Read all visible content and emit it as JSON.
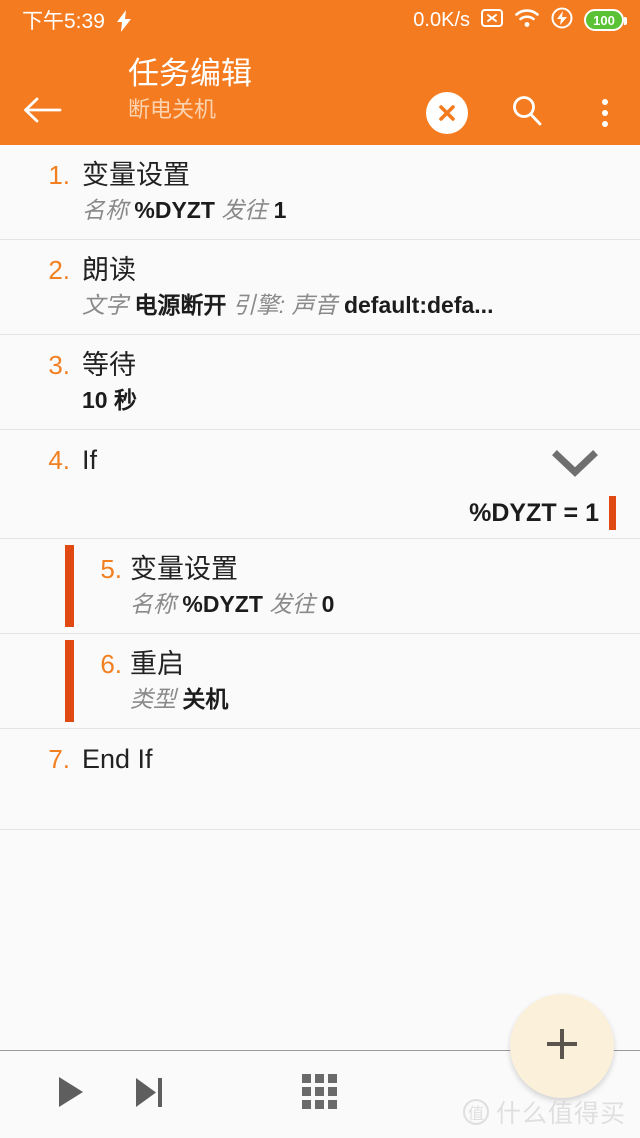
{
  "statusbar": {
    "time": "下午5:39",
    "charging_icon": "lightning-bolt-icon",
    "data_rate": "0.0K/s",
    "sim_icon": "no-sim-icon",
    "wifi_icon": "wifi-icon",
    "power_icon": "power-saver-icon",
    "battery_level": "100",
    "background_color": "#F47B20"
  },
  "appbar": {
    "back_icon": "back-arrow-icon",
    "title": "任务编辑",
    "subtitle": "断电关机",
    "close_icon": "close-circle-icon",
    "search_icon": "search-icon",
    "more_icon": "overflow-menu-icon",
    "background_color": "#F47B20",
    "accent_color": "#F28021"
  },
  "actions": [
    {
      "number": "1.",
      "title": "变量设置",
      "indented": false,
      "parts": [
        {
          "type": "label",
          "text": "名称"
        },
        {
          "type": "value",
          "text": "%DYZT"
        },
        {
          "type": "label",
          "text": "发往"
        },
        {
          "type": "value",
          "text": "1"
        }
      ]
    },
    {
      "number": "2.",
      "title": "朗读",
      "indented": false,
      "parts": [
        {
          "type": "label",
          "text": "文字"
        },
        {
          "type": "value",
          "text": "电源断开"
        },
        {
          "type": "label",
          "text": "引擎: 声音"
        },
        {
          "type": "value",
          "text": "default:defa..."
        }
      ]
    },
    {
      "number": "3.",
      "title": "等待",
      "indented": false,
      "parts": [
        {
          "type": "value",
          "text": "10 秒"
        }
      ]
    },
    {
      "number": "4.",
      "title": "If",
      "indented": false,
      "is_if": true,
      "chevron_icon": "chevron-down-icon",
      "condition": "%DYZT = 1",
      "condition_bar_color": "#E04A12",
      "parts": []
    },
    {
      "number": "5.",
      "title": "变量设置",
      "indented": true,
      "parts": [
        {
          "type": "label",
          "text": "名称"
        },
        {
          "type": "value",
          "text": "%DYZT"
        },
        {
          "type": "label",
          "text": "发往"
        },
        {
          "type": "value",
          "text": "0"
        }
      ]
    },
    {
      "number": "6.",
      "title": "重启",
      "indented": true,
      "parts": [
        {
          "type": "label",
          "text": "类型"
        },
        {
          "type": "value",
          "text": "关机"
        }
      ]
    },
    {
      "number": "7.",
      "title": "End If",
      "indented": false,
      "is_endif": true,
      "parts": []
    }
  ],
  "fab": {
    "icon": "plus-icon",
    "background_color": "#FBF0DA"
  },
  "bottombar": {
    "play_icon": "play-icon",
    "step_icon": "skip-next-icon",
    "grid_icon": "grid-apps-icon"
  },
  "watermark": {
    "badge": "值",
    "text": "什么值得买"
  }
}
